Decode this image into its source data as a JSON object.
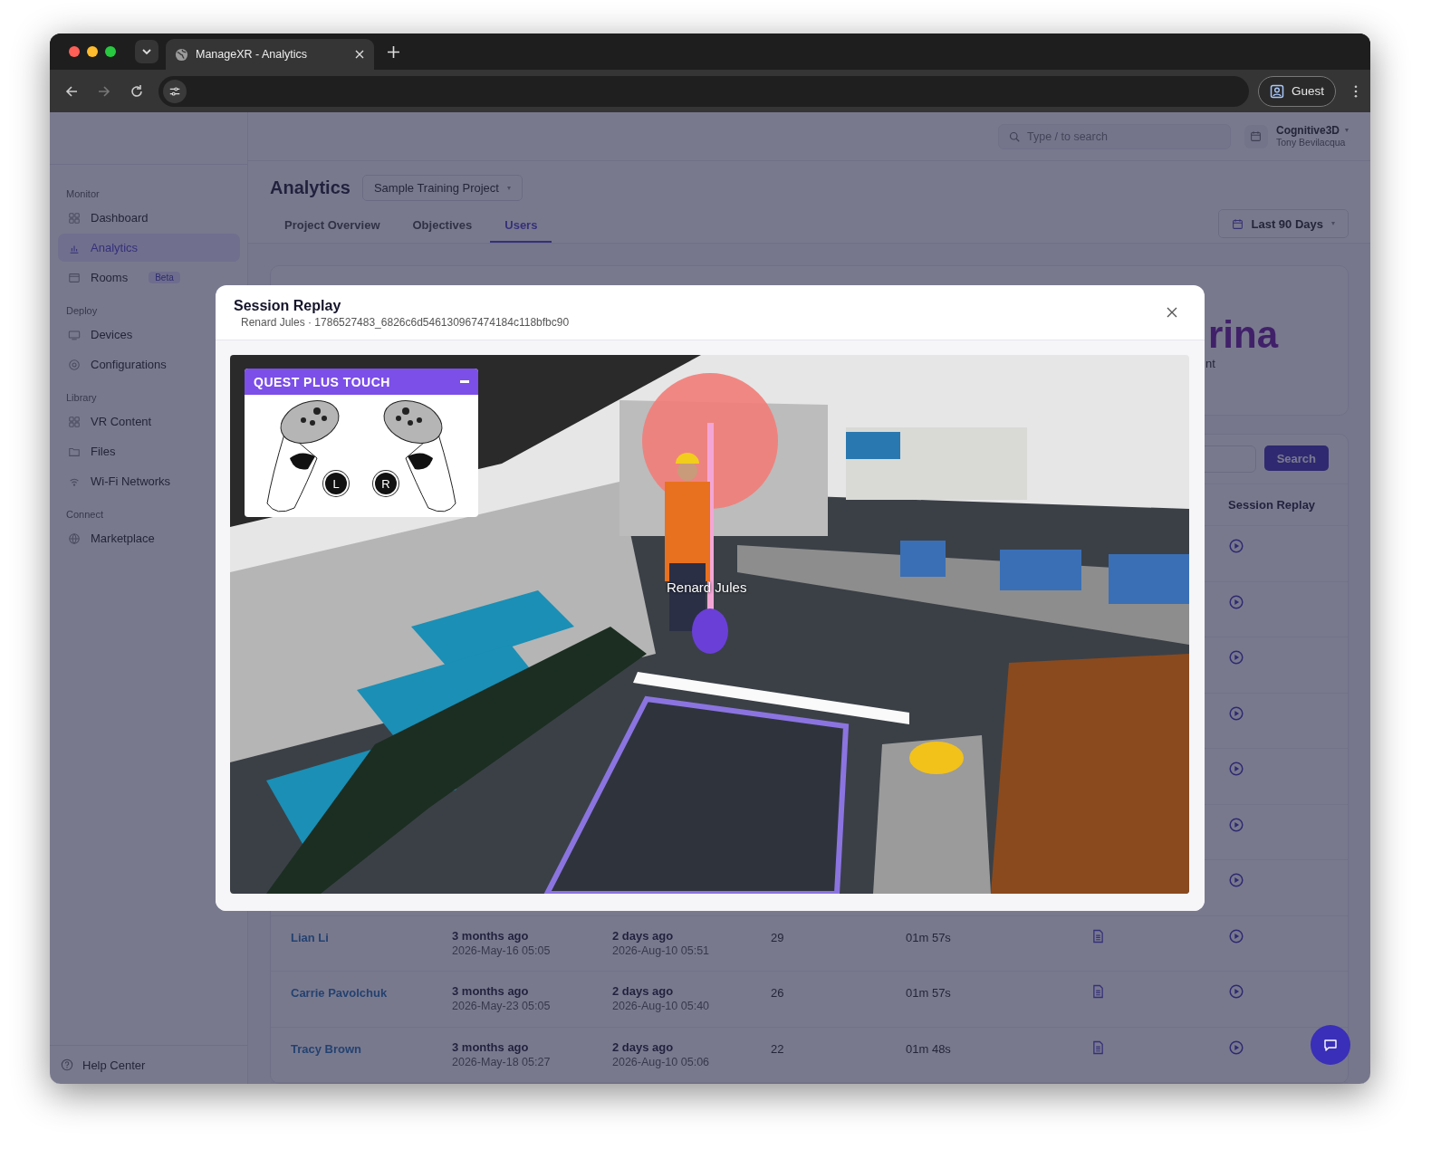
{
  "browser": {
    "tab_title": "ManageXR - Analytics",
    "profile_label": "Guest"
  },
  "header": {
    "search": {
      "placeholder": "Type / to search"
    },
    "org": {
      "name": "Cognitive3D",
      "user": "Tony Bevilacqua"
    }
  },
  "sidebar": {
    "sections": [
      {
        "heading": "Monitor",
        "items": [
          {
            "label": "Dashboard",
            "selected": false
          },
          {
            "label": "Analytics",
            "selected": true
          },
          {
            "label": "Rooms",
            "selected": false,
            "badge": "Beta"
          }
        ]
      },
      {
        "heading": "Deploy",
        "items": [
          {
            "label": "Devices",
            "selected": false
          },
          {
            "label": "Configurations",
            "selected": false
          }
        ]
      },
      {
        "heading": "Library",
        "items": [
          {
            "label": "VR Content",
            "selected": false
          },
          {
            "label": "Files",
            "selected": false
          },
          {
            "label": "Wi-Fi Networks",
            "selected": false
          }
        ]
      },
      {
        "heading": "Connect",
        "items": [
          {
            "label": "Marketplace",
            "selected": false
          }
        ]
      }
    ],
    "help": "Help Center"
  },
  "page": {
    "title": "Analytics",
    "project": "Sample Training Project",
    "tabs": [
      {
        "label": "Project Overview",
        "selected": false
      },
      {
        "label": "Objectives",
        "selected": false
      },
      {
        "label": "Users",
        "selected": true
      }
    ],
    "date_range": "Last 90 Days"
  },
  "summary_card": {
    "heading_fragment": "rina",
    "caption_fragment": "nt"
  },
  "users_table": {
    "search_button": "Search",
    "replay_heading": "Session Replay",
    "rows": [
      {
        "kind": "covered"
      },
      {
        "kind": "covered"
      },
      {
        "kind": "covered"
      },
      {
        "kind": "covered"
      },
      {
        "kind": "covered"
      },
      {
        "kind": "covered"
      },
      {
        "kind": "covered"
      },
      {
        "kind": "full",
        "name": "Lian Li",
        "first_session": {
          "relative": "3 months ago",
          "date": "2026-May-16 05:05"
        },
        "last_session": {
          "relative": "2 days ago",
          "date": "2026-Aug-10 05:51"
        },
        "count": "29",
        "duration": "01m 57s"
      },
      {
        "kind": "full",
        "name": "Carrie Pavolchuk",
        "first_session": {
          "relative": "3 months ago",
          "date": "2026-May-23 05:05"
        },
        "last_session": {
          "relative": "2 days ago",
          "date": "2026-Aug-10 05:40"
        },
        "count": "26",
        "duration": "01m 57s"
      },
      {
        "kind": "full",
        "name": "Tracy Brown",
        "first_session": {
          "relative": "3 months ago",
          "date": "2026-May-18 05:27"
        },
        "last_session": {
          "relative": "2 days ago",
          "date": "2026-Aug-10 05:06"
        },
        "count": "22",
        "duration": "01m 48s"
      }
    ]
  },
  "modal": {
    "title": "Session Replay",
    "subtitle": "Renard Jules · 1786527483_6826c6d546130967474184c118bfbc90",
    "controller_panel": {
      "title": "QUEST PLUS TOUCH",
      "left_label": "L",
      "right_label": "R"
    },
    "player_label": "Renard Jules"
  }
}
